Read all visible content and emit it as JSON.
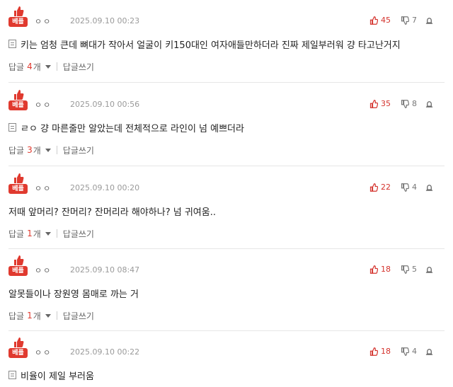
{
  "badge_label": "베플",
  "reply_label": "답글",
  "reply_unit": "개",
  "write_label": "답글쓰기",
  "colors": {
    "accent": "#e03a2f",
    "like": "#d4322c"
  },
  "comments": [
    {
      "nick": "ㅇㅇ",
      "date": "2025.09.10 00:23",
      "likes": "45",
      "dislikes": "7",
      "has_doc_icon": true,
      "text": "키는 엄청 큰데 뼈대가 작아서 얼굴이 키150대인 여자애들만하더라 진짜 제일부러워 걍 타고난거지",
      "replies": "4"
    },
    {
      "nick": "ㅇㅇ",
      "date": "2025.09.10 00:56",
      "likes": "35",
      "dislikes": "8",
      "has_doc_icon": true,
      "text": "ㄹㅇ 걍 마른줄만 알았는데 전체적으로 라인이 넘 예쁘더라",
      "replies": "3"
    },
    {
      "nick": "ㅇㅇ",
      "date": "2025.09.10 00:20",
      "likes": "22",
      "dislikes": "4",
      "has_doc_icon": false,
      "text": "저때 앞머리? 잔머리? 잔머리라 해야하나? 넘 귀여움..",
      "replies": "1"
    },
    {
      "nick": "ㅇㅇ",
      "date": "2025.09.10 08:47",
      "likes": "18",
      "dislikes": "5",
      "has_doc_icon": false,
      "text": "알못들이나 장원영 몸매로 까는 거",
      "replies": "1"
    },
    {
      "nick": "ㅇㅇ",
      "date": "2025.09.10 00:22",
      "likes": "18",
      "dislikes": "4",
      "has_doc_icon": true,
      "text": "비율이 제일 부러움",
      "replies": ""
    }
  ]
}
